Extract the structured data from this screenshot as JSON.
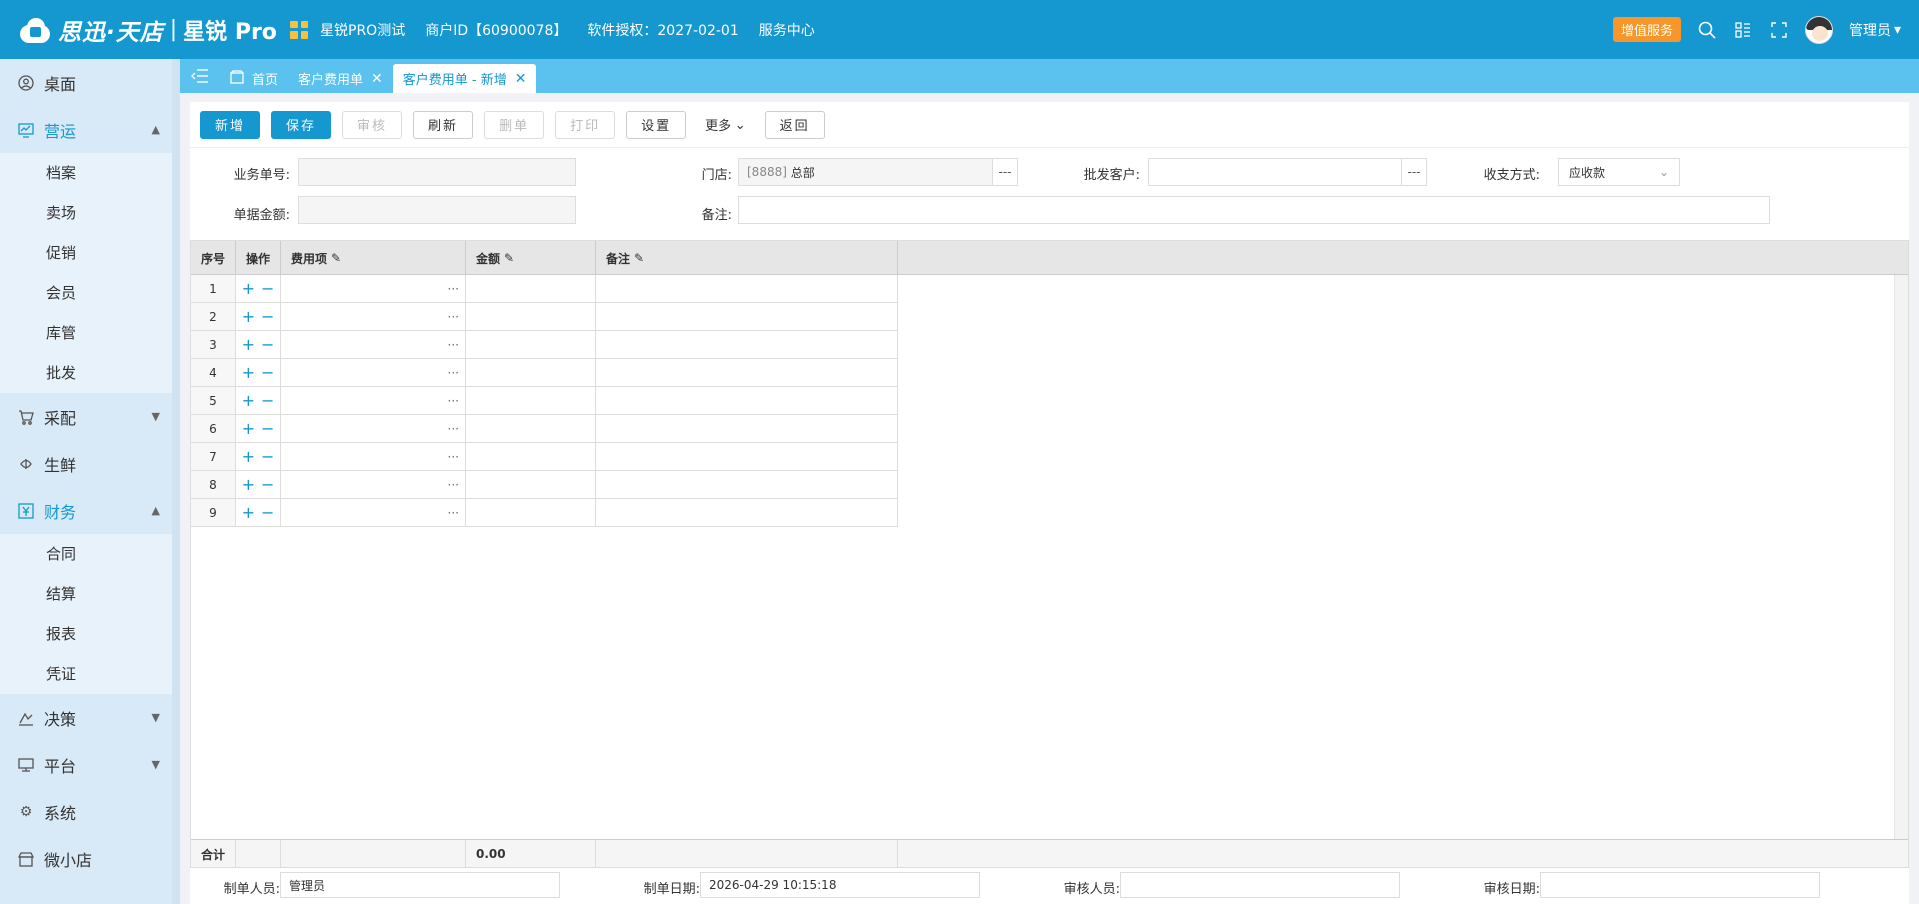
{
  "header": {
    "brand": "思迅·天店",
    "sep": "|",
    "product": "星锐 Pro",
    "store_name": "星锐PRO测试",
    "merchant_id": "商户ID【60900078】",
    "license": "软件授权：2027-02-01",
    "service_center": "服务中心",
    "vas_button": "增值服务",
    "user": "管理员"
  },
  "sidebar": {
    "desktop": "桌面",
    "operations": "营运",
    "operations_sub": [
      "档案",
      "卖场",
      "促销",
      "会员",
      "库管",
      "批发"
    ],
    "distribution": "采配",
    "fresh": "生鲜",
    "finance": "财务",
    "finance_sub": [
      "合同",
      "结算",
      "报表",
      "凭证"
    ],
    "decision": "决策",
    "platform": "平台",
    "system": "系统",
    "mini_store": "微小店"
  },
  "tabs": {
    "home": "首页",
    "customer_fee": "客户费用单",
    "customer_fee_new": "客户费用单 - 新增"
  },
  "toolbar": {
    "new": "新增",
    "save": "保存",
    "audit": "审核",
    "refresh": "刷新",
    "delete": "删单",
    "print": "打印",
    "settings": "设置",
    "more": "更多",
    "back": "返回"
  },
  "form": {
    "doc_no_label": "业务单号:",
    "doc_no_value": "",
    "amount_label": "单据金额:",
    "amount_value": "",
    "store_label": "门店:",
    "store_code": "[8888]",
    "store_name": "总部",
    "remark_label": "备注:",
    "remark_value": "",
    "customer_label": "批发客户:",
    "customer_value": "",
    "pay_label": "收支方式:",
    "pay_value": "应收款",
    "dots": "---"
  },
  "grid": {
    "headers": [
      "序号",
      "操作",
      "费用项",
      "金额",
      "备注"
    ],
    "rows": [
      "1",
      "2",
      "3",
      "4",
      "5",
      "6",
      "7",
      "8",
      "9"
    ],
    "ops_plus": "+",
    "ops_minus": "−",
    "ellipsis": "···",
    "total_label": "合计",
    "total_amount": "0.00"
  },
  "footer": {
    "creator_label": "制单人员:",
    "creator_value": "管理员",
    "create_date_label": "制单日期:",
    "create_date_value": "2026-04-29 10:15:18",
    "auditor_label": "审核人员:",
    "auditor_value": "",
    "audit_date_label": "审核日期:",
    "audit_date_value": ""
  },
  "colors": {
    "primary": "#1597d0",
    "tabbar": "#5bc2ef",
    "sidebar": "#d8e9f7",
    "vas": "#f6962b"
  }
}
